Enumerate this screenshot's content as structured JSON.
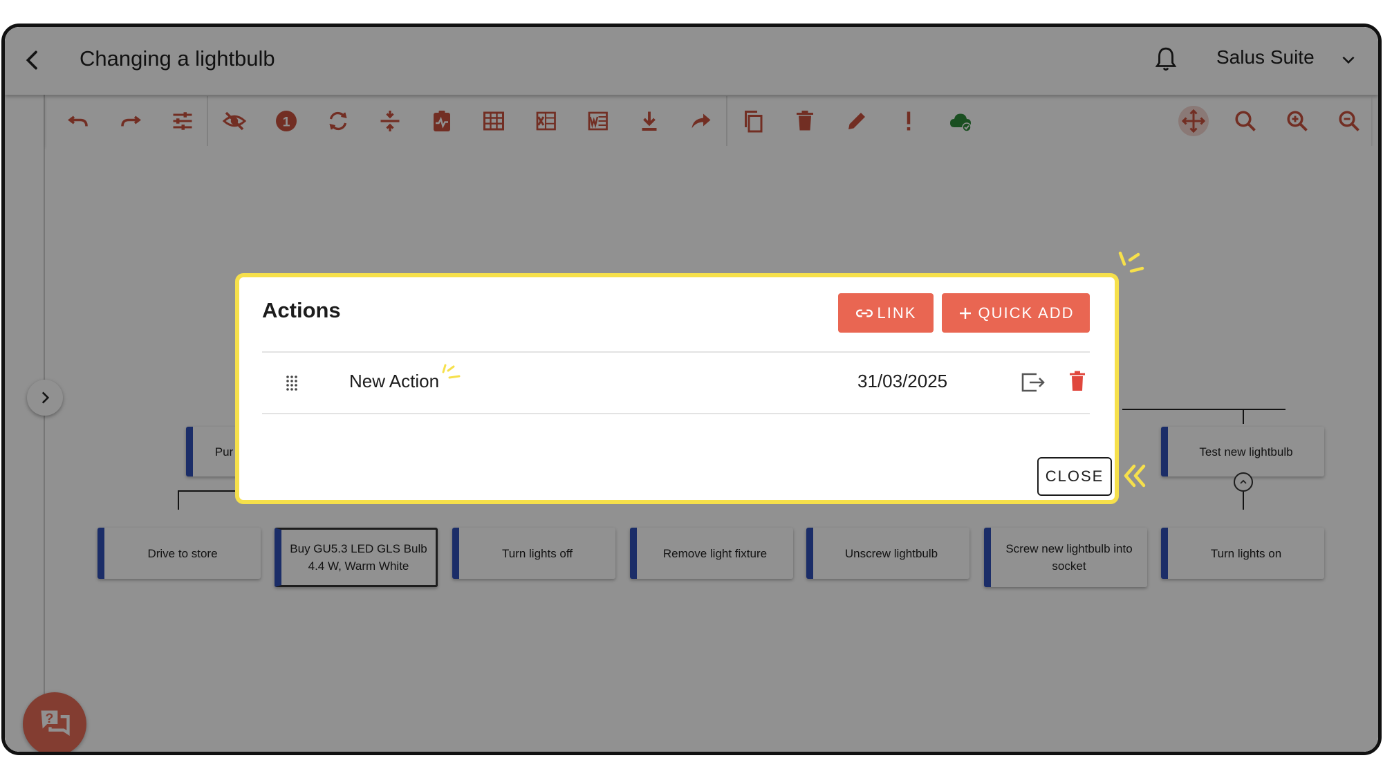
{
  "header": {
    "title": "Changing a lightbulb",
    "suite_name": "Salus Suite"
  },
  "toolbar": {
    "icons": [
      "undo-icon",
      "redo-icon",
      "tune-icon",
      "visibility-off-icon",
      "alert-circle-icon",
      "refresh-icon",
      "align-icon",
      "clipboard-pulse-icon",
      "table-icon",
      "excel-icon",
      "word-icon",
      "download-icon",
      "share-icon",
      "copy-icon",
      "delete-icon",
      "edit-icon",
      "exclamation-icon",
      "cloud-check-icon",
      "move-icon",
      "search-icon",
      "zoom-in-icon",
      "zoom-out-icon"
    ],
    "accent": "#c9513f",
    "cloud_color": "#2e8b3a"
  },
  "tree": {
    "nodes": [
      {
        "label": "Pur"
      },
      {
        "label": "Test new lightbulb"
      },
      {
        "label": "Drive to store"
      },
      {
        "label": "Buy GU5.3 LED GLS Bulb 4.4 W, Warm White"
      },
      {
        "label": "Turn lights off"
      },
      {
        "label": "Remove light fixture"
      },
      {
        "label": "Unscrew lightbulb"
      },
      {
        "label": "Screw new lightbulb into socket"
      },
      {
        "label": "Turn lights on"
      }
    ],
    "node_accent": "#3050b8"
  },
  "dialog": {
    "title": "Actions",
    "link_label": "LINK",
    "quick_add_label": "QUICK ADD",
    "actions": [
      {
        "label": "New Action",
        "date": "31/03/2025"
      }
    ],
    "close_label": "CLOSE",
    "highlight_color": "#f6e04b",
    "button_color": "#e96652"
  }
}
